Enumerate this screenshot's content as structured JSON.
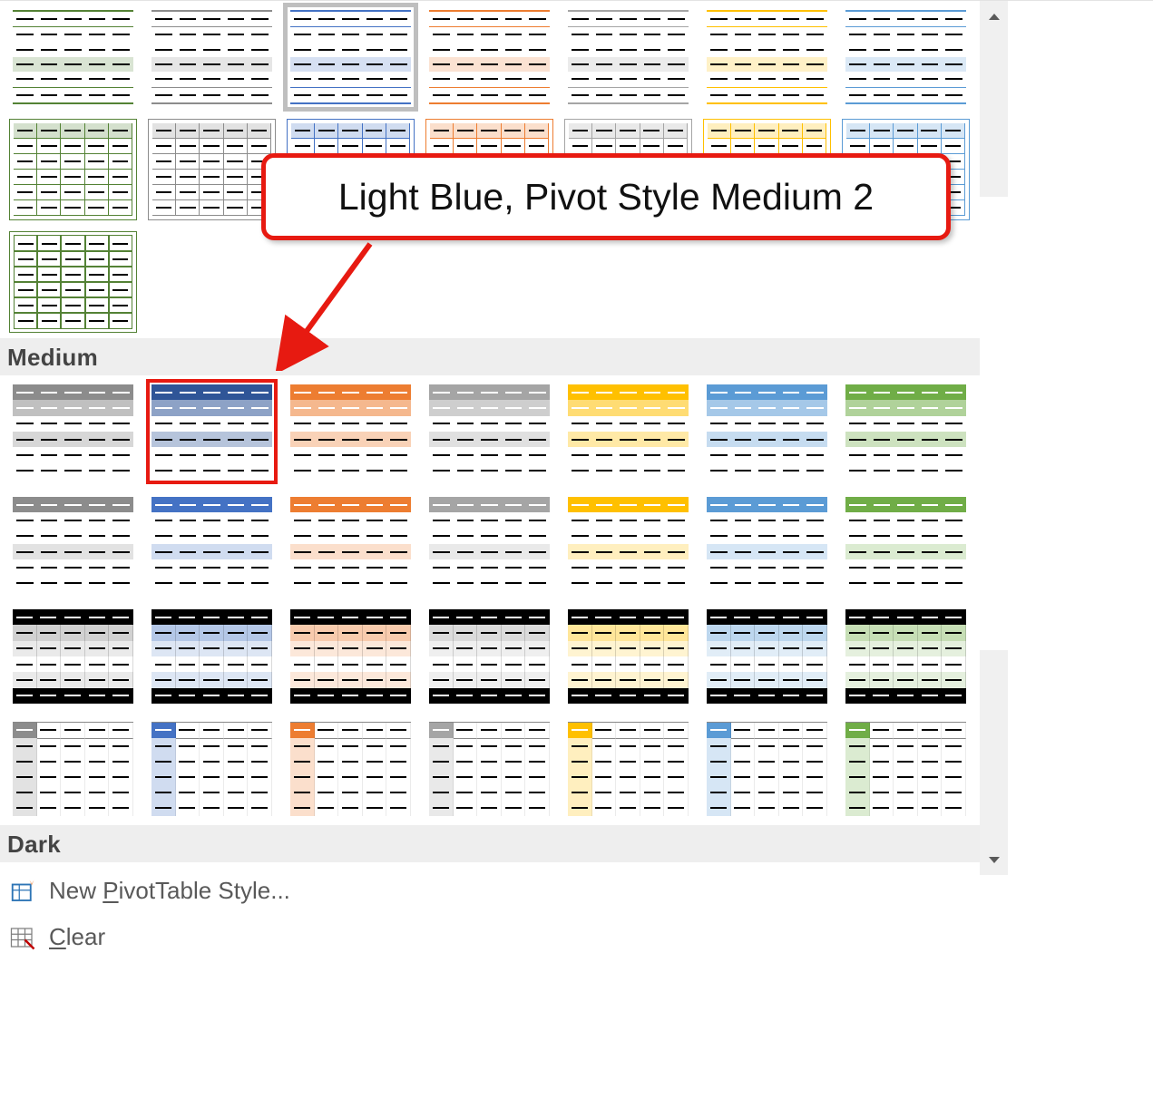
{
  "sections": {
    "medium_label": "Medium",
    "dark_label": "Dark"
  },
  "menu": {
    "new_style_label": "New PivotTable Style...",
    "new_style_key": "P",
    "clear_label": "Clear",
    "clear_key": "C"
  },
  "callout": {
    "text": "Light Blue, Pivot Style Medium 2"
  },
  "colors": {
    "gray": "#8c8c8c",
    "blue": "#4472c4",
    "orange": "#ed7d31",
    "silver": "#a5a5a5",
    "gold": "#ffc000",
    "light_blue": "#5b9bd5",
    "green": "#70ad47"
  },
  "light_styles": {
    "row2": [
      "green",
      "gray",
      "blue",
      "orange",
      "silver",
      "gold",
      "light_blue"
    ],
    "row3": [
      "green",
      "gray"
    ],
    "row4": [
      "green"
    ]
  },
  "medium_styles": {
    "row1": [
      "gray",
      "blue",
      "orange",
      "silver",
      "gold",
      "light_blue",
      "green"
    ],
    "row2": [
      "gray",
      "blue",
      "orange",
      "silver",
      "gold",
      "light_blue",
      "green"
    ],
    "row3": [
      "gray",
      "blue",
      "orange",
      "silver",
      "gold",
      "light_blue",
      "green"
    ],
    "row4": [
      "gray",
      "blue",
      "orange",
      "silver",
      "gold",
      "light_blue",
      "green"
    ]
  },
  "selected_light_index": 2,
  "highlighted_medium_index": 1
}
